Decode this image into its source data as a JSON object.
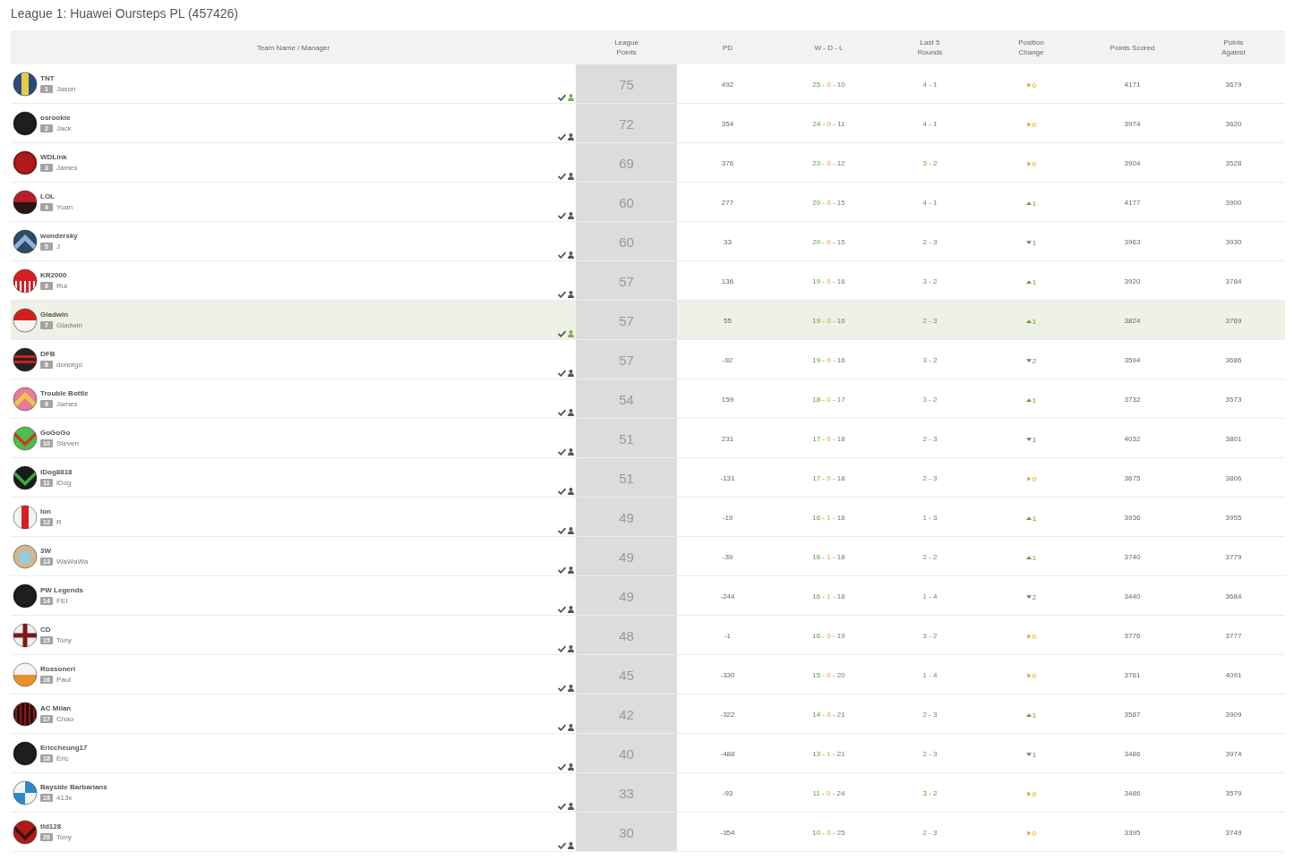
{
  "title": "League 1: Huawei Oursteps PL (457426)",
  "columns": [
    "Team Name / Manager",
    "League Points",
    "PD",
    "W - D - L",
    "Last 5 Rounds",
    "Position Change",
    "Points Scored",
    "Points Against"
  ],
  "rows": [
    {
      "team": "TNT",
      "rank": "1",
      "manager": "Jason",
      "active": true,
      "highlighted": false,
      "badge": {
        "kind": "center-stripe",
        "color": "#2b4a7a",
        "accent": {
          "color": "#e2cf48"
        }
      },
      "points": "75",
      "pd": "492",
      "record": [
        {
          "kind": "win",
          "text": "25"
        },
        {
          "kind": "sep",
          "text": "-"
        },
        {
          "kind": "draw",
          "text": "0"
        },
        {
          "kind": "sep",
          "text": "-"
        },
        {
          "kind": "loss",
          "text": "10"
        }
      ],
      "last5": [
        {
          "kind": "win",
          "text": "4"
        },
        {
          "kind": "sep",
          "text": "-"
        },
        {
          "kind": "loss",
          "text": "1"
        }
      ],
      "position_change": {
        "kind": "same",
        "value": "0"
      },
      "scored": "4171",
      "against": "3679"
    },
    {
      "team": "osrookie",
      "rank": "2",
      "manager": "Jack",
      "active": false,
      "highlighted": false,
      "badge": {
        "kind": "plain",
        "color": "#1e1e1e"
      },
      "points": "72",
      "pd": "354",
      "record": [
        {
          "kind": "win",
          "text": "24"
        },
        {
          "kind": "sep",
          "text": "-"
        },
        {
          "kind": "draw",
          "text": "0"
        },
        {
          "kind": "sep",
          "text": "-"
        },
        {
          "kind": "loss",
          "text": "11"
        }
      ],
      "last5": [
        {
          "kind": "win",
          "text": "4"
        },
        {
          "kind": "sep",
          "text": "-"
        },
        {
          "kind": "loss",
          "text": "1"
        }
      ],
      "position_change": {
        "kind": "same",
        "value": "0"
      },
      "scored": "3974",
      "against": "3620"
    },
    {
      "team": "WDLink",
      "rank": "3",
      "manager": "James",
      "active": false,
      "highlighted": false,
      "badge": {
        "kind": "plain",
        "color": "#b01a1a"
      },
      "points": "69",
      "pd": "376",
      "record": [
        {
          "kind": "win",
          "text": "23"
        },
        {
          "kind": "sep",
          "text": "-"
        },
        {
          "kind": "draw",
          "text": "0"
        },
        {
          "kind": "sep",
          "text": "-"
        },
        {
          "kind": "loss",
          "text": "12"
        }
      ],
      "last5": [
        {
          "kind": "win",
          "text": "3"
        },
        {
          "kind": "sep",
          "text": "-"
        },
        {
          "kind": "loss",
          "text": "2"
        }
      ],
      "position_change": {
        "kind": "same",
        "value": "0"
      },
      "scored": "3904",
      "against": "3528"
    },
    {
      "team": "LOL",
      "rank": "4",
      "manager": "Yuan",
      "active": false,
      "highlighted": false,
      "badge": {
        "kind": "half",
        "color": "#b81e28",
        "accent": {
          "color": "#2a1414"
        }
      },
      "points": "60",
      "pd": "277",
      "record": [
        {
          "kind": "win",
          "text": "20"
        },
        {
          "kind": "sep",
          "text": "-"
        },
        {
          "kind": "draw",
          "text": "0"
        },
        {
          "kind": "sep",
          "text": "-"
        },
        {
          "kind": "loss",
          "text": "15"
        }
      ],
      "last5": [
        {
          "kind": "win",
          "text": "4"
        },
        {
          "kind": "sep",
          "text": "-"
        },
        {
          "kind": "loss",
          "text": "1"
        }
      ],
      "position_change": {
        "kind": "up",
        "value": "1"
      },
      "scored": "4177",
      "against": "3900"
    },
    {
      "team": "wondersky",
      "rank": "5",
      "manager": "J",
      "active": false,
      "highlighted": false,
      "badge": {
        "kind": "chevron-up",
        "color": "#2c4a6a",
        "accent": {
          "color": "#8fb3d9"
        }
      },
      "points": "60",
      "pd": "33",
      "record": [
        {
          "kind": "win",
          "text": "20"
        },
        {
          "kind": "sep",
          "text": "-"
        },
        {
          "kind": "draw",
          "text": "0"
        },
        {
          "kind": "sep",
          "text": "-"
        },
        {
          "kind": "loss",
          "text": "15"
        }
      ],
      "last5": [
        {
          "kind": "win",
          "text": "2"
        },
        {
          "kind": "sep",
          "text": "-"
        },
        {
          "kind": "loss",
          "text": "3"
        }
      ],
      "position_change": {
        "kind": "down",
        "value": "1"
      },
      "scored": "3963",
      "against": "3930"
    },
    {
      "team": "KR2000",
      "rank": "6",
      "manager": "Rui",
      "active": false,
      "highlighted": false,
      "badge": {
        "kind": "lower-stripes",
        "color": "#d42020",
        "accent": {
          "color": "#ffffff"
        }
      },
      "points": "57",
      "pd": "136",
      "record": [
        {
          "kind": "win",
          "text": "19"
        },
        {
          "kind": "sep",
          "text": "-"
        },
        {
          "kind": "draw",
          "text": "0"
        },
        {
          "kind": "sep",
          "text": "-"
        },
        {
          "kind": "loss",
          "text": "16"
        }
      ],
      "last5": [
        {
          "kind": "win",
          "text": "3"
        },
        {
          "kind": "sep",
          "text": "-"
        },
        {
          "kind": "loss",
          "text": "2"
        }
      ],
      "position_change": {
        "kind": "up",
        "value": "1"
      },
      "scored": "3920",
      "against": "3784"
    },
    {
      "team": "Gladwin",
      "rank": "7",
      "manager": "Gladwin",
      "active": true,
      "highlighted": true,
      "badge": {
        "kind": "half",
        "color": "#d02020",
        "accent": {
          "color": "#f4f4f4"
        }
      },
      "points": "57",
      "pd": "55",
      "record": [
        {
          "kind": "win",
          "text": "19"
        },
        {
          "kind": "sep",
          "text": "-"
        },
        {
          "kind": "draw",
          "text": "0"
        },
        {
          "kind": "sep",
          "text": "-"
        },
        {
          "kind": "loss",
          "text": "16"
        }
      ],
      "last5": [
        {
          "kind": "win",
          "text": "2"
        },
        {
          "kind": "sep",
          "text": "-"
        },
        {
          "kind": "loss",
          "text": "3"
        }
      ],
      "position_change": {
        "kind": "up",
        "value": "1"
      },
      "scored": "3824",
      "against": "3769"
    },
    {
      "team": "DFB",
      "rank": "8",
      "manager": "donotgo",
      "active": false,
      "highlighted": false,
      "badge": {
        "kind": "hoops",
        "color": "#222222",
        "accent": {
          "color": "#c82020"
        }
      },
      "points": "57",
      "pd": "-92",
      "record": [
        {
          "kind": "win",
          "text": "19"
        },
        {
          "kind": "sep",
          "text": "-"
        },
        {
          "kind": "draw",
          "text": "0"
        },
        {
          "kind": "sep",
          "text": "-"
        },
        {
          "kind": "loss",
          "text": "16"
        }
      ],
      "last5": [
        {
          "kind": "win",
          "text": "3"
        },
        {
          "kind": "sep",
          "text": "-"
        },
        {
          "kind": "loss",
          "text": "2"
        }
      ],
      "position_change": {
        "kind": "down",
        "value": "2"
      },
      "scored": "3594",
      "against": "3686"
    },
    {
      "team": "Trouble Bottle",
      "rank": "9",
      "manager": "James",
      "active": false,
      "highlighted": false,
      "badge": {
        "kind": "chevron-up",
        "color": "#e87a9a",
        "accent": {
          "color": "#e8c84a"
        }
      },
      "points": "54",
      "pd": "159",
      "record": [
        {
          "kind": "win",
          "text": "18"
        },
        {
          "kind": "sep",
          "text": "-"
        },
        {
          "kind": "draw",
          "text": "0"
        },
        {
          "kind": "sep",
          "text": "-"
        },
        {
          "kind": "loss",
          "text": "17"
        }
      ],
      "last5": [
        {
          "kind": "win",
          "text": "3"
        },
        {
          "kind": "sep",
          "text": "-"
        },
        {
          "kind": "loss",
          "text": "2"
        }
      ],
      "position_change": {
        "kind": "up",
        "value": "1"
      },
      "scored": "3732",
      "against": "3573"
    },
    {
      "team": "GoGoGo",
      "rank": "10",
      "manager": "Steven",
      "active": false,
      "highlighted": false,
      "badge": {
        "kind": "chevron-down",
        "color": "#4cbf4c",
        "accent": {
          "color": "#c83a2a"
        }
      },
      "points": "51",
      "pd": "231",
      "record": [
        {
          "kind": "win",
          "text": "17"
        },
        {
          "kind": "sep",
          "text": "-"
        },
        {
          "kind": "draw",
          "text": "0"
        },
        {
          "kind": "sep",
          "text": "-"
        },
        {
          "kind": "loss",
          "text": "18"
        }
      ],
      "last5": [
        {
          "kind": "win",
          "text": "2"
        },
        {
          "kind": "sep",
          "text": "-"
        },
        {
          "kind": "loss",
          "text": "3"
        }
      ],
      "position_change": {
        "kind": "down",
        "value": "1"
      },
      "scored": "4032",
      "against": "3801"
    },
    {
      "team": "iDog8818",
      "rank": "11",
      "manager": "iDog",
      "active": false,
      "highlighted": false,
      "badge": {
        "kind": "chevron-down",
        "color": "#1a1a1a",
        "accent": {
          "color": "#3aaa3a"
        }
      },
      "points": "51",
      "pd": "-131",
      "record": [
        {
          "kind": "win",
          "text": "17"
        },
        {
          "kind": "sep",
          "text": "-"
        },
        {
          "kind": "draw",
          "text": "0"
        },
        {
          "kind": "sep",
          "text": "-"
        },
        {
          "kind": "loss",
          "text": "18"
        }
      ],
      "last5": [
        {
          "kind": "win",
          "text": "2"
        },
        {
          "kind": "sep",
          "text": "-"
        },
        {
          "kind": "loss",
          "text": "3"
        }
      ],
      "position_change": {
        "kind": "same",
        "value": "0"
      },
      "scored": "3675",
      "against": "3806"
    },
    {
      "team": "Ion",
      "rank": "12",
      "manager": "R",
      "active": false,
      "highlighted": false,
      "badge": {
        "kind": "center-stripe",
        "color": "#f4f4f4",
        "accent": {
          "color": "#d42020"
        }
      },
      "points": "49",
      "pd": "-19",
      "record": [
        {
          "kind": "win",
          "text": "16"
        },
        {
          "kind": "sep",
          "text": "-"
        },
        {
          "kind": "draw",
          "text": "1"
        },
        {
          "kind": "sep",
          "text": "-"
        },
        {
          "kind": "loss",
          "text": "18"
        }
      ],
      "last5": [
        {
          "kind": "win",
          "text": "1"
        },
        {
          "kind": "sep",
          "text": "-"
        },
        {
          "kind": "loss",
          "text": "3"
        }
      ],
      "position_change": {
        "kind": "up",
        "value": "1"
      },
      "scored": "3936",
      "against": "3955"
    },
    {
      "team": "3W",
      "rank": "13",
      "manager": "WaWaWa",
      "active": false,
      "highlighted": false,
      "badge": {
        "kind": "star",
        "color": "#d8b48a",
        "accent": {
          "color": "#8fd0e0"
        }
      },
      "points": "49",
      "pd": "-39",
      "record": [
        {
          "kind": "win",
          "text": "16"
        },
        {
          "kind": "sep",
          "text": "-"
        },
        {
          "kind": "draw",
          "text": "1"
        },
        {
          "kind": "sep",
          "text": "-"
        },
        {
          "kind": "loss",
          "text": "18"
        }
      ],
      "last5": [
        {
          "kind": "win",
          "text": "2"
        },
        {
          "kind": "sep",
          "text": "-"
        },
        {
          "kind": "loss",
          "text": "2"
        }
      ],
      "position_change": {
        "kind": "up",
        "value": "1"
      },
      "scored": "3740",
      "against": "3779"
    },
    {
      "team": "PW Legends",
      "rank": "14",
      "manager": "FEI",
      "active": false,
      "highlighted": false,
      "badge": {
        "kind": "plain",
        "color": "#1e1e1e"
      },
      "points": "49",
      "pd": "-244",
      "record": [
        {
          "kind": "win",
          "text": "16"
        },
        {
          "kind": "sep",
          "text": "-"
        },
        {
          "kind": "draw",
          "text": "1"
        },
        {
          "kind": "sep",
          "text": "-"
        },
        {
          "kind": "loss",
          "text": "18"
        }
      ],
      "last5": [
        {
          "kind": "win",
          "text": "1"
        },
        {
          "kind": "sep",
          "text": "-"
        },
        {
          "kind": "loss",
          "text": "4"
        }
      ],
      "position_change": {
        "kind": "down",
        "value": "2"
      },
      "scored": "3440",
      "against": "3684"
    },
    {
      "team": "CD",
      "rank": "15",
      "manager": "Tony",
      "active": false,
      "highlighted": false,
      "badge": {
        "kind": "cross",
        "color": "#f0f0f0",
        "accent": {
          "color": "#7a1a1a"
        }
      },
      "points": "48",
      "pd": "-1",
      "record": [
        {
          "kind": "win",
          "text": "16"
        },
        {
          "kind": "sep",
          "text": "-"
        },
        {
          "kind": "draw",
          "text": "0"
        },
        {
          "kind": "sep",
          "text": "-"
        },
        {
          "kind": "loss",
          "text": "19"
        }
      ],
      "last5": [
        {
          "kind": "win",
          "text": "3"
        },
        {
          "kind": "sep",
          "text": "-"
        },
        {
          "kind": "loss",
          "text": "2"
        }
      ],
      "position_change": {
        "kind": "same",
        "value": "0"
      },
      "scored": "3776",
      "against": "3777"
    },
    {
      "team": "Rossoneri",
      "rank": "16",
      "manager": "Paul",
      "active": false,
      "highlighted": false,
      "badge": {
        "kind": "half",
        "color": "#f4f4f4",
        "accent": {
          "color": "#e8902a"
        }
      },
      "points": "45",
      "pd": "-330",
      "record": [
        {
          "kind": "win",
          "text": "15"
        },
        {
          "kind": "sep",
          "text": "-"
        },
        {
          "kind": "draw",
          "text": "0"
        },
        {
          "kind": "sep",
          "text": "-"
        },
        {
          "kind": "loss",
          "text": "20"
        }
      ],
      "last5": [
        {
          "kind": "win",
          "text": "1"
        },
        {
          "kind": "sep",
          "text": "-"
        },
        {
          "kind": "loss",
          "text": "4"
        }
      ],
      "position_change": {
        "kind": "same",
        "value": "0"
      },
      "scored": "3761",
      "against": "4091"
    },
    {
      "team": "AC Milan",
      "rank": "17",
      "manager": "Chao",
      "active": false,
      "highlighted": false,
      "badge": {
        "kind": "stripes",
        "color": "#2a0e0e",
        "accent": {
          "color": "#8a1a1a"
        }
      },
      "points": "42",
      "pd": "-322",
      "record": [
        {
          "kind": "win",
          "text": "14"
        },
        {
          "kind": "sep",
          "text": "-"
        },
        {
          "kind": "draw",
          "text": "0"
        },
        {
          "kind": "sep",
          "text": "-"
        },
        {
          "kind": "loss",
          "text": "21"
        }
      ],
      "last5": [
        {
          "kind": "win",
          "text": "2"
        },
        {
          "kind": "sep",
          "text": "-"
        },
        {
          "kind": "loss",
          "text": "3"
        }
      ],
      "position_change": {
        "kind": "up",
        "value": "1"
      },
      "scored": "3587",
      "against": "3909"
    },
    {
      "team": "Ericcheung17",
      "rank": "18",
      "manager": "Eric",
      "active": false,
      "highlighted": false,
      "badge": {
        "kind": "plain",
        "color": "#1e1e1e"
      },
      "points": "40",
      "pd": "-488",
      "record": [
        {
          "kind": "win",
          "text": "13"
        },
        {
          "kind": "sep",
          "text": "-"
        },
        {
          "kind": "draw",
          "text": "1"
        },
        {
          "kind": "sep",
          "text": "-"
        },
        {
          "kind": "loss",
          "text": "21"
        }
      ],
      "last5": [
        {
          "kind": "win",
          "text": "2"
        },
        {
          "kind": "sep",
          "text": "-"
        },
        {
          "kind": "loss",
          "text": "3"
        }
      ],
      "position_change": {
        "kind": "down",
        "value": "1"
      },
      "scored": "3486",
      "against": "3974"
    },
    {
      "team": "Bayside Barbarians",
      "rank": "19",
      "manager": "413x",
      "active": false,
      "highlighted": false,
      "badge": {
        "kind": "quarters",
        "color": "#2a8ac8",
        "accent": {
          "color": "#f4f4f4"
        }
      },
      "points": "33",
      "pd": "-93",
      "record": [
        {
          "kind": "win",
          "text": "11"
        },
        {
          "kind": "sep",
          "text": "-"
        },
        {
          "kind": "draw",
          "text": "0"
        },
        {
          "kind": "sep",
          "text": "-"
        },
        {
          "kind": "loss",
          "text": "24"
        }
      ],
      "last5": [
        {
          "kind": "win",
          "text": "3"
        },
        {
          "kind": "sep",
          "text": "-"
        },
        {
          "kind": "loss",
          "text": "2"
        }
      ],
      "position_change": {
        "kind": "same",
        "value": "0"
      },
      "scored": "3486",
      "against": "3579"
    },
    {
      "team": "tld128",
      "rank": "20",
      "manager": "Tony",
      "active": false,
      "highlighted": false,
      "badge": {
        "kind": "chevron-down",
        "color": "#b01a1a",
        "accent": {
          "color": "#3a1010"
        }
      },
      "points": "30",
      "pd": "-354",
      "record": [
        {
          "kind": "win",
          "text": "10"
        },
        {
          "kind": "sep",
          "text": "-"
        },
        {
          "kind": "draw",
          "text": "0"
        },
        {
          "kind": "sep",
          "text": "-"
        },
        {
          "kind": "loss",
          "text": "25"
        }
      ],
      "last5": [
        {
          "kind": "win",
          "text": "2"
        },
        {
          "kind": "sep",
          "text": "-"
        },
        {
          "kind": "loss",
          "text": "3"
        }
      ],
      "position_change": {
        "kind": "same",
        "value": "0"
      },
      "scored": "3395",
      "against": "3749"
    }
  ]
}
